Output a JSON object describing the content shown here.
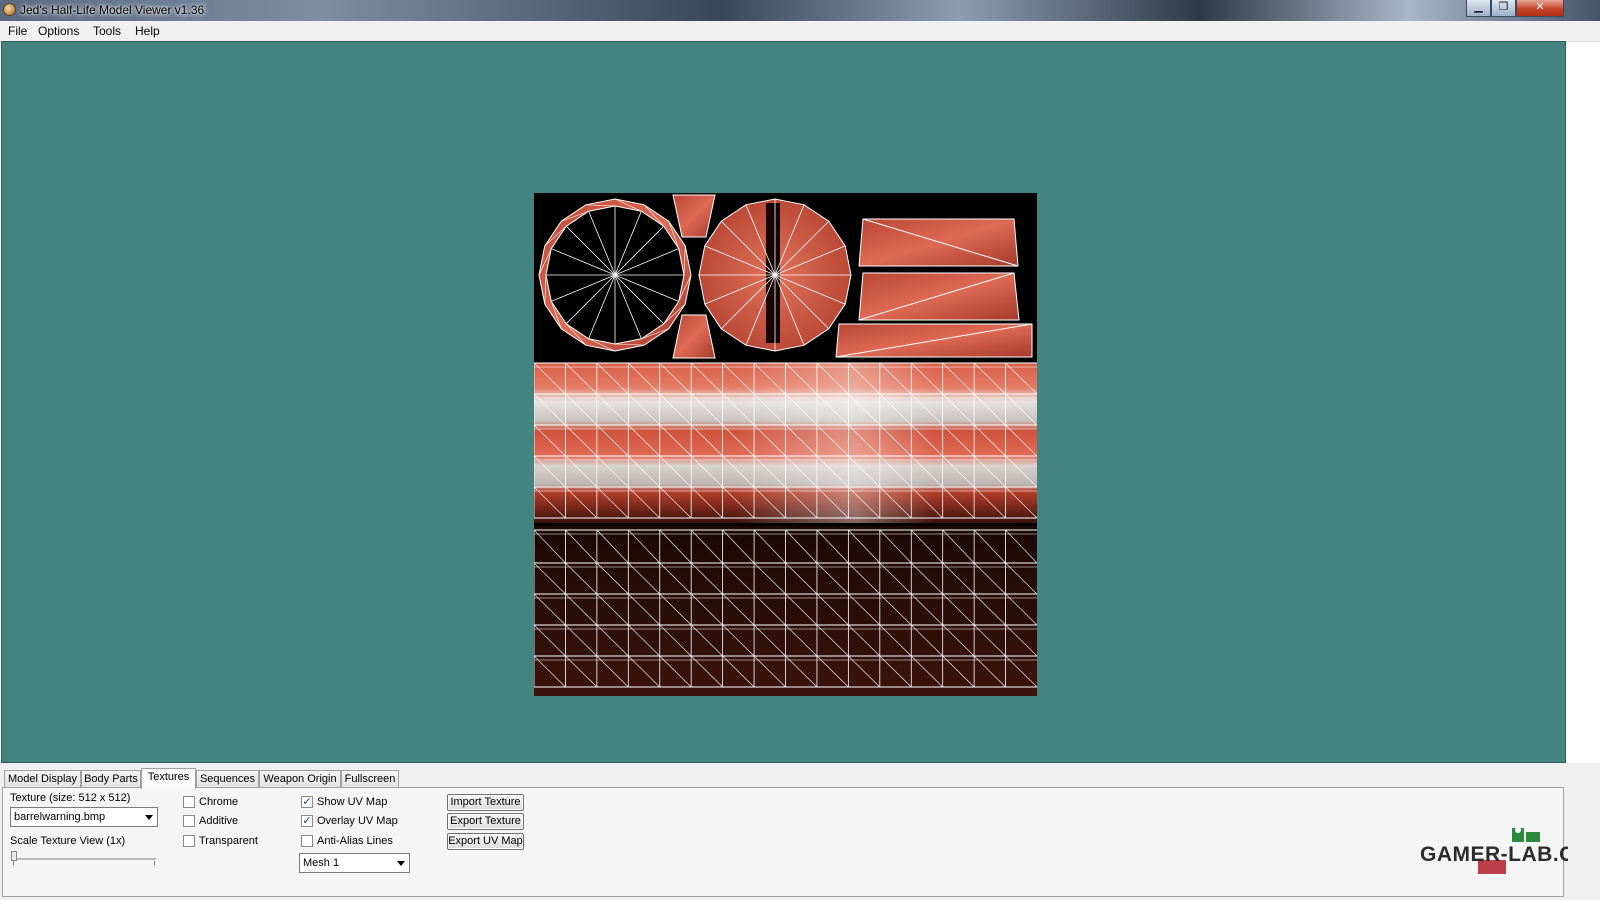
{
  "window": {
    "title": "Jed's Half-Life Model Viewer v1.36",
    "min_symbol": "▁",
    "max_symbol": "❐",
    "close_symbol": "✕"
  },
  "menu": [
    "File",
    "Options",
    "Tools",
    "Help"
  ],
  "viewport": {
    "background": "#448480"
  },
  "tabs": [
    {
      "label": "Model Display",
      "active": false
    },
    {
      "label": "Body Parts",
      "active": false
    },
    {
      "label": "Textures",
      "active": true
    },
    {
      "label": "Sequences",
      "active": false
    },
    {
      "label": "Weapon Origin",
      "active": false
    },
    {
      "label": "Fullscreen",
      "active": false
    }
  ],
  "textures": {
    "texture_label": "Texture (size: 512 x 512)",
    "texture_selected": "barrelwarning.bmp",
    "scale_label": "Scale Texture View (1x)",
    "scale_value": 0,
    "checkboxes_left": [
      {
        "label": "Chrome",
        "checked": false
      },
      {
        "label": "Additive",
        "checked": false
      },
      {
        "label": "Transparent",
        "checked": false
      }
    ],
    "checkboxes_right": [
      {
        "label": "Show UV Map",
        "checked": true
      },
      {
        "label": "Overlay UV Map",
        "checked": true
      },
      {
        "label": "Anti-Alias Lines",
        "checked": false
      }
    ],
    "mesh_selected": "Mesh 1",
    "buttons": [
      "Import Texture",
      "Export Texture",
      "Export UV Map"
    ]
  },
  "watermark": "GAMER-LAB.COM"
}
